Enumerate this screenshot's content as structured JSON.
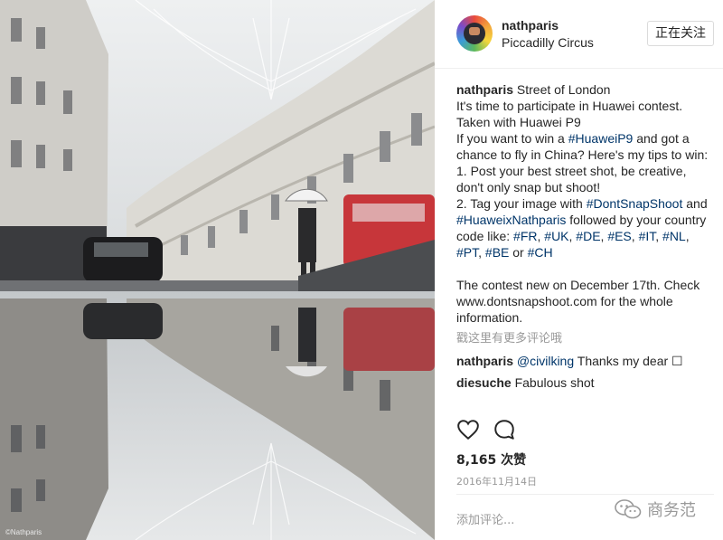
{
  "post": {
    "photo_credit": "©Nathparis"
  },
  "header": {
    "username": "nathparis",
    "location": "Piccadilly Circus",
    "follow_label": "正在关注"
  },
  "caption": {
    "username": "nathparis",
    "title": "Street of London",
    "lines": [
      "It's time to participate in Huawei contest.",
      "Taken with Huawei P9"
    ],
    "p1_pre": "If you want to win a ",
    "p1_tag": "#HuaweiP9",
    "p1_post": " and got a chance to fly in China? Here's my tips to win:",
    "tip1": "1. Post your best street shot, be creative, don't only snap but shoot!",
    "tip2_pre": "2. Tag your image with ",
    "tip2_tag1": "#DontSnapShoot",
    "tip2_mid": " and ",
    "tip2_tag2": "#HuaweixNathparis",
    "tip2_post": " followed by your country code like: ",
    "codes": [
      "#FR",
      "#UK",
      "#DE",
      "#ES",
      "#IT",
      "#NL",
      "#PT",
      "#BE",
      "#CH"
    ],
    "code_sep": ", ",
    "code_or": " or ",
    "closing": "The contest new on December 17th. Check www.dontsnapshoot.com for the whole information."
  },
  "more_comments": "戳这里有更多评论哦",
  "comments": [
    {
      "user": "nathparis",
      "mention": "@civilking",
      "text": " Thanks my dear ☐"
    },
    {
      "user": "diesuche",
      "mention": "",
      "text": " Fabulous shot"
    }
  ],
  "actions": {
    "like_icon": "heart-icon",
    "comment_icon": "speech-bubble-icon"
  },
  "likes": "8,165 次赞",
  "date": "2016年11月14日",
  "add_comment_placeholder": "添加评论...",
  "watermark": {
    "text": "商务范",
    "icon": "wechat-icon"
  },
  "colors": {
    "hashtag": "#003569",
    "muted": "#999999",
    "text": "#262626",
    "border": "#dbdbdb"
  }
}
